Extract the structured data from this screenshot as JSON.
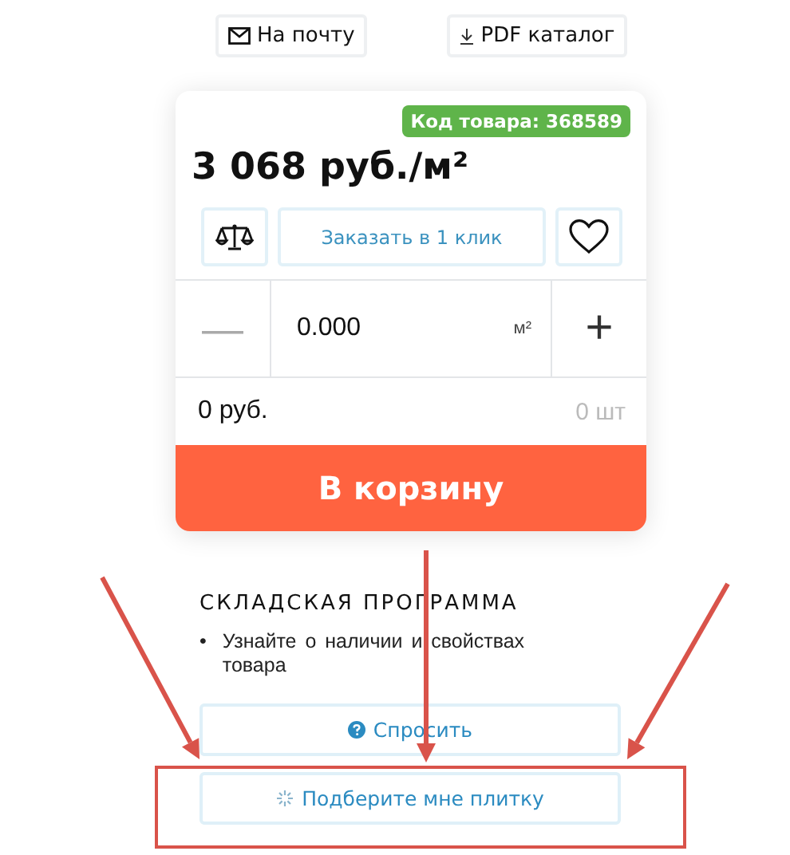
{
  "share_buttons": [
    {
      "kind": "mail",
      "label": "На почту"
    },
    {
      "kind": "download",
      "label": "PDF каталог"
    }
  ],
  "product": {
    "code_badge": "Код товара: 368589",
    "price": "3 068 руб./м²",
    "one_click": "Заказать в 1 клик",
    "quantity": {
      "minus": "—",
      "value": "0.000",
      "unit": "м²",
      "plus": "+"
    },
    "total": "0 руб.",
    "pieces": "0 шт",
    "add_to_cart": "В корзину"
  },
  "stock": {
    "title": "СКЛАДСКАЯ ПРОГРАММА",
    "bullets": [
      {
        "marker": "•",
        "text": "Узнайте о наличии и свойствах товара"
      }
    ],
    "buttons": [
      {
        "kind": "ask",
        "label": "Спросить"
      },
      {
        "kind": "pick",
        "label": "Подберите мне плитку"
      }
    ]
  }
}
